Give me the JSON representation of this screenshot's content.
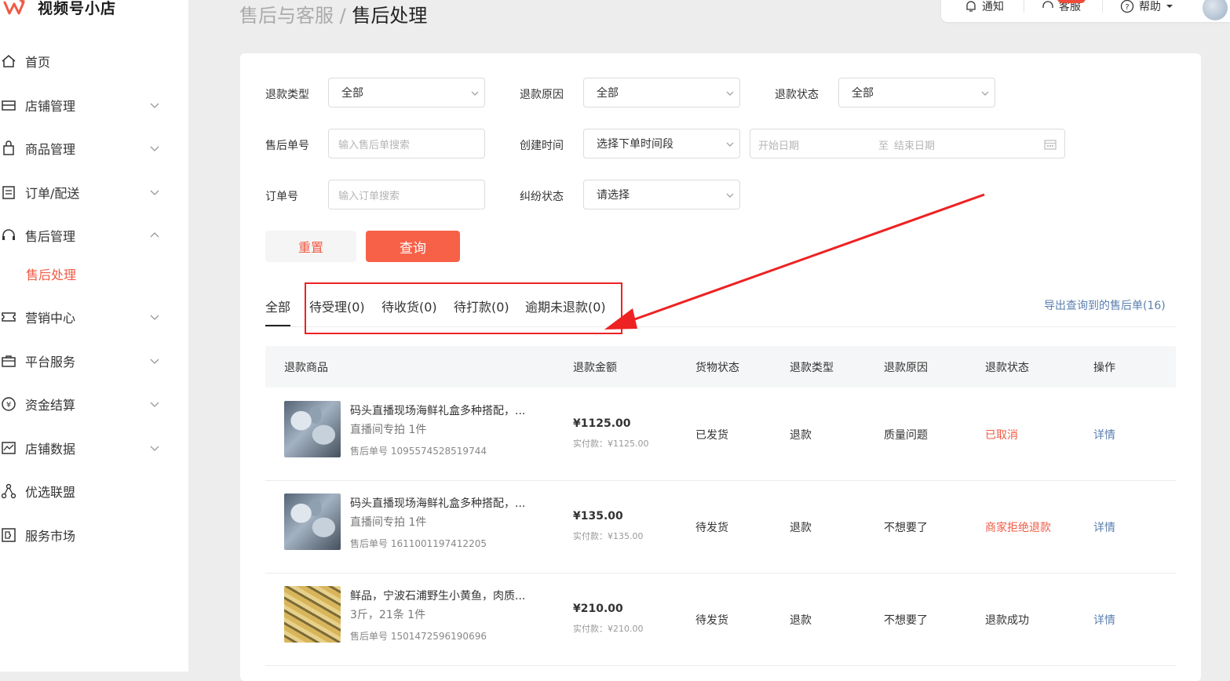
{
  "app": {
    "name": "视频号小店"
  },
  "sidebar": {
    "items": [
      {
        "label": "首页",
        "icon": "home-icon"
      },
      {
        "label": "店铺管理",
        "icon": "store-icon"
      },
      {
        "label": "商品管理",
        "icon": "shopping-bag-icon"
      },
      {
        "label": "订单/配送",
        "icon": "order-list-icon"
      },
      {
        "label": "售后管理",
        "icon": "headset-icon"
      },
      {
        "label": "售后处理",
        "icon": ""
      },
      {
        "label": "营销中心",
        "icon": "ticket-icon"
      },
      {
        "label": "平台服务",
        "icon": "briefcase-icon"
      },
      {
        "label": "资金结算",
        "icon": "yen-icon"
      },
      {
        "label": "店铺数据",
        "icon": "chart-icon"
      },
      {
        "label": "优选联盟",
        "icon": "network-icon"
      },
      {
        "label": "服务市场",
        "icon": "puzzle-icon"
      }
    ]
  },
  "breadcrumb": {
    "parent": "售后与客服",
    "separator": " / ",
    "current": "售后处理"
  },
  "topbar": {
    "notify": "通知",
    "service": "客服",
    "help": "帮助"
  },
  "filters": {
    "refund_type": {
      "label": "退款类型",
      "value": "全部"
    },
    "refund_reason": {
      "label": "退款原因",
      "value": "全部"
    },
    "refund_status": {
      "label": "退款状态",
      "value": "全部"
    },
    "aftersale_no": {
      "label": "售后单号",
      "placeholder": "输入售后单搜索"
    },
    "create_time": {
      "label": "创建时间",
      "value": "选择下单时间段"
    },
    "date_range": {
      "start_placeholder": "开始日期",
      "to": "至",
      "end_placeholder": "结束日期"
    },
    "order_no": {
      "label": "订单号",
      "placeholder": "输入订单搜索"
    },
    "dispute_status": {
      "label": "纠纷状态",
      "value": "请选择"
    }
  },
  "buttons": {
    "reset": "重置",
    "search": "查询"
  },
  "tabs": [
    "全部",
    "待受理(0)",
    "待收货(0)",
    "待打款(0)",
    "逾期未退款(0)"
  ],
  "export_link": "导出查询到的售后单(16)",
  "table": {
    "headers": [
      "退款商品",
      "退款金额",
      "货物状态",
      "退款类型",
      "退款原因",
      "退款状态",
      "操作"
    ],
    "rows": [
      {
        "title": "码头直播现场海鲜礼盒多种搭配，...",
        "spec": "直播间专拍 1件",
        "no": "售后单号 1095574528519744",
        "amount": "¥1125.00",
        "paid": "实付款：¥1125.00",
        "goods_status": "已发货",
        "type": "退款",
        "reason": "质量问题",
        "status": "已取消",
        "action": "详情"
      },
      {
        "title": "码头直播现场海鲜礼盒多种搭配，...",
        "spec": "直播间专拍 1件",
        "no": "售后单号 1611001197412205",
        "amount": "¥135.00",
        "paid": "实付款：¥135.00",
        "goods_status": "待发货",
        "type": "退款",
        "reason": "不想要了",
        "status": "商家拒绝退款",
        "action": "详情"
      },
      {
        "title": "鲜品，宁波石浦野生小黄鱼，肉质...",
        "spec": "3斤，21条 1件",
        "no": "售后单号 1501472596190696",
        "amount": "¥210.00",
        "paid": "实付款：¥210.00",
        "goods_status": "待发货",
        "type": "退款",
        "reason": "不想要了",
        "status": "退款成功",
        "action": "详情"
      }
    ]
  },
  "colors": {
    "accent": "#f76148",
    "status_red": "#f05a45",
    "link": "#5b7fae",
    "annotation": "#ee2222"
  }
}
